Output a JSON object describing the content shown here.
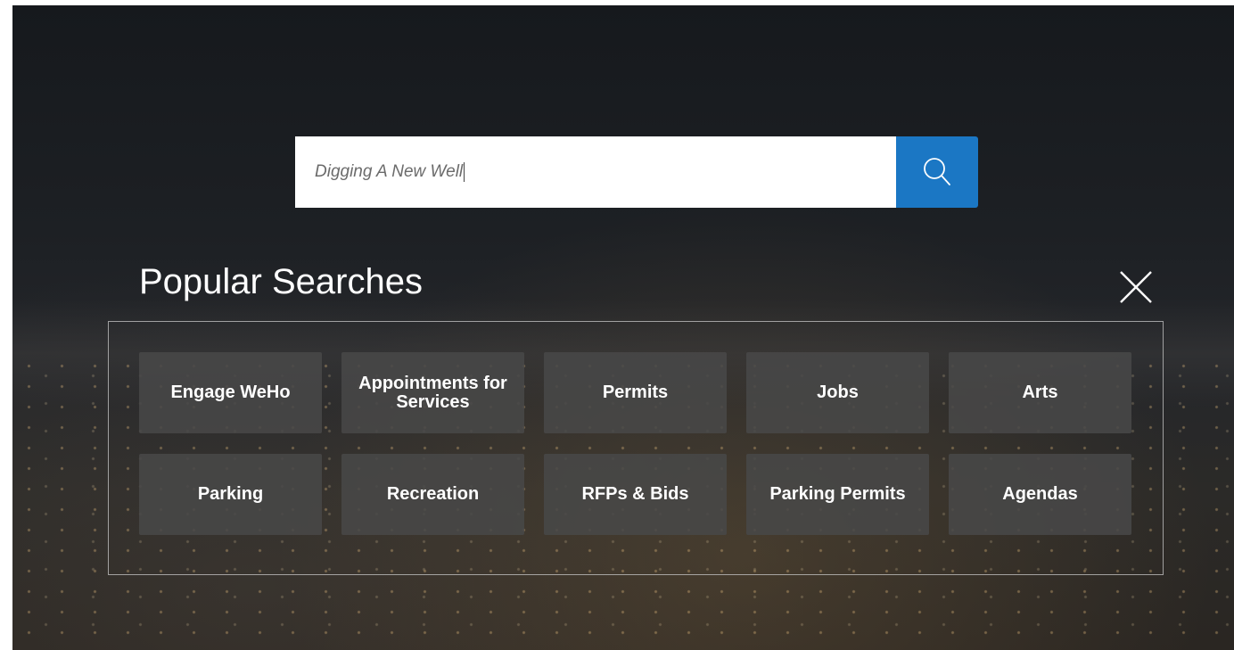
{
  "search": {
    "value": "Digging A New Well",
    "button_icon": "search-icon"
  },
  "popular": {
    "title": "Popular Searches",
    "close_icon": "close-icon",
    "items": [
      {
        "label": "Engage WeHo"
      },
      {
        "label": "Appointments for Services"
      },
      {
        "label": "Permits"
      },
      {
        "label": "Jobs"
      },
      {
        "label": "Arts"
      },
      {
        "label": "Parking"
      },
      {
        "label": "Recreation"
      },
      {
        "label": "RFPs & Bids"
      },
      {
        "label": "Parking Permits"
      },
      {
        "label": "Agendas"
      }
    ]
  },
  "colors": {
    "accent": "#1b77c4",
    "tile": "#484848",
    "text": "#ffffff"
  }
}
